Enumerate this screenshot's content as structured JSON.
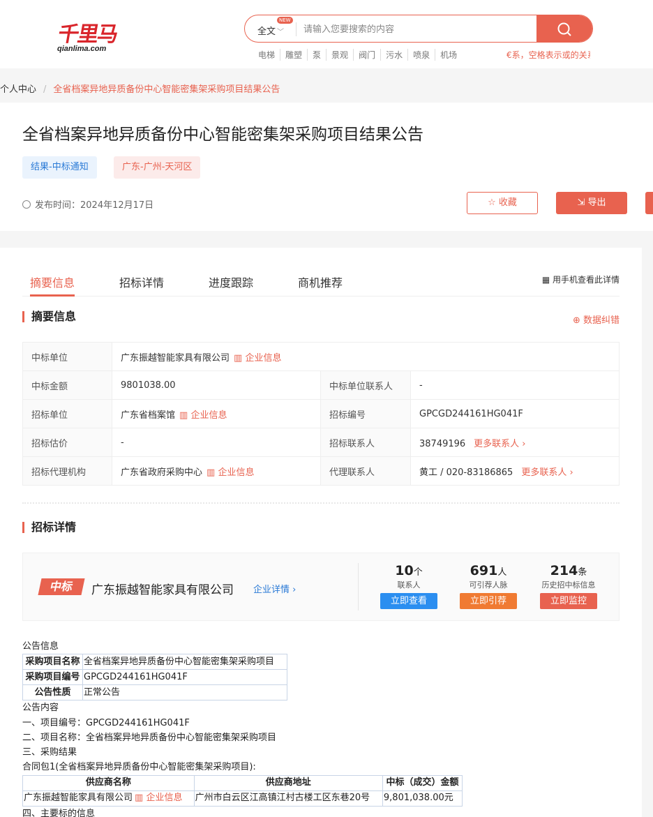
{
  "header": {
    "logo_text": "千里马",
    "logo_sub": "qianlima.com",
    "search_scope": "全文",
    "search_new_badge": "NEW",
    "search_placeholder": "请输入您要搜索的内容",
    "hotwords": [
      "电梯",
      "雕塑",
      "泵",
      "景观",
      "阀门",
      "污水",
      "喷泉",
      "机场"
    ],
    "search_hint": "€系，空格表示或的关系"
  },
  "breadcrumb": {
    "home": "个人中心",
    "separator": "/",
    "current": "全省档案异地异质备份中心智能密集架采购项目结果公告"
  },
  "title_card": {
    "title": "全省档案异地异质备份中心智能密集架采购项目结果公告",
    "tag_type": "结果-中标通知",
    "tag_region": "广东-广州-天河区",
    "publish_time": "发布时间：2024年12月17日",
    "favorite_label": "收藏",
    "export_label": "导出"
  },
  "tabs": {
    "items": [
      "摘要信息",
      "招标详情",
      "进度跟踪",
      "商机推荐"
    ],
    "active": "摘要信息",
    "mobile_view": "用手机查看此详情"
  },
  "summary": {
    "heading": "摘要信息",
    "correct_label": "数据纠错",
    "enterprise_info": "企业信息",
    "more_contacts": "更多联系人 ›",
    "rows": {
      "winner_label": "中标单位",
      "winner_value": "广东振越智能家具有限公司",
      "amount_label": "中标金额",
      "amount_value": "9801038.00",
      "winner_contact_label": "中标单位联系人",
      "winner_contact_value": "-",
      "tenderer_label": "招标单位",
      "tenderer_value": "广东省档案馆",
      "tender_no_label": "招标编号",
      "tender_no_value": "GPCGD244161HG041F",
      "estimate_label": "招标估价",
      "estimate_value": "-",
      "tender_contact_label": "招标联系人",
      "tender_contact_value": "38749196",
      "agency_label": "招标代理机构",
      "agency_value": "广东省政府采购中心",
      "agency_contact_label": "代理联系人",
      "agency_contact_value": "黄工 / 020-83186865"
    }
  },
  "details": {
    "heading": "招标详情",
    "badge": "中标",
    "company": "广东振越智能家具有限公司",
    "company_link": "企业详情 ›",
    "stats": [
      {
        "num": "10",
        "unit": "个",
        "label": "联系人",
        "button": "立即查看",
        "color": "#2b8ef0"
      },
      {
        "num": "691",
        "unit": "人",
        "label": "可引荐人脉",
        "button": "立即引荐",
        "color": "#f07a32"
      },
      {
        "num": "214",
        "unit": "条",
        "label": "历史招中标信息",
        "button": "立即监控",
        "color": "#e8624f"
      }
    ]
  },
  "notice": {
    "info_heading": "公告信息",
    "info_table": [
      {
        "k": "采购项目名称",
        "v": "全省档案异地异质备份中心智能密集架采购项目"
      },
      {
        "k": "采购项目编号",
        "v": "GPCGD244161HG041F"
      },
      {
        "k": "公告性质",
        "v": "正常公告"
      }
    ],
    "content_heading": "公告内容",
    "line1": "一、项目编号：GPCGD244161HG041F",
    "line2": "二、项目名称：全省档案异地异质备份中心智能密集架采购项目",
    "line3": "三、采购结果",
    "package": "合同包1(全省档案异地异质备份中心智能密集架采购项目):",
    "result_headers": [
      "供应商名称",
      "供应商地址",
      "中标（成交）金额"
    ],
    "result_row": {
      "name": "广东振越智能家具有限公司",
      "link": "企业信息",
      "address": "广州市白云区江高镇江村古楼工区东巷20号",
      "amount": "9,801,038.00元"
    },
    "line4": "四、主要标的信息"
  },
  "colors": {
    "accent": "#e8624f",
    "link_blue": "#2a7ad6"
  }
}
